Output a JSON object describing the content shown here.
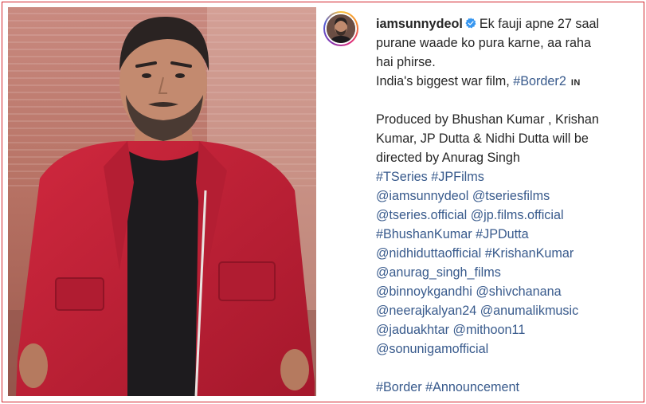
{
  "post": {
    "username": "iamsunnydeol",
    "caption_first_line_1": "Ek fauji apne 27 saal",
    "caption_lines": [
      "purane waade ko pura karne, aa raha",
      "hai phirse."
    ],
    "tagline_text": "India's biggest war film, ",
    "tagline_hashtag": "#Border2",
    "lang_badge": "IN",
    "produced_lines": [
      "Produced by Bhushan Kumar , Krishan",
      "Kumar, JP Dutta & Nidhi Dutta will be",
      "directed by Anurag Singh"
    ],
    "tag_lines": [
      [
        "#TSeries",
        "#JPFilms"
      ],
      [
        "@iamsunnydeol",
        "@tseriesfilms"
      ],
      [
        "@tseries.official",
        "@jp.films.official"
      ],
      [
        "#BhushanKumar",
        "#JPDutta"
      ],
      [
        "@nidhiduttaofficial",
        "#KrishanKumar"
      ],
      [
        "@anurag_singh_films"
      ],
      [
        "@binnoykgandhi",
        "@shivchanana"
      ],
      [
        "@neerajkalyan24",
        "@anumalikmusic"
      ],
      [
        "@jaduakhtar",
        "@mithoon11"
      ],
      [
        "@sonunigamofficial"
      ]
    ],
    "final_tags": [
      "#Border",
      "#Announcement"
    ]
  },
  "icons": {
    "verified": "verified-badge-icon",
    "avatar": "profile-avatar"
  },
  "colors": {
    "frame_border": "#d2232a",
    "link": "#385a8c",
    "verified": "#3897f0",
    "text": "#262626"
  }
}
